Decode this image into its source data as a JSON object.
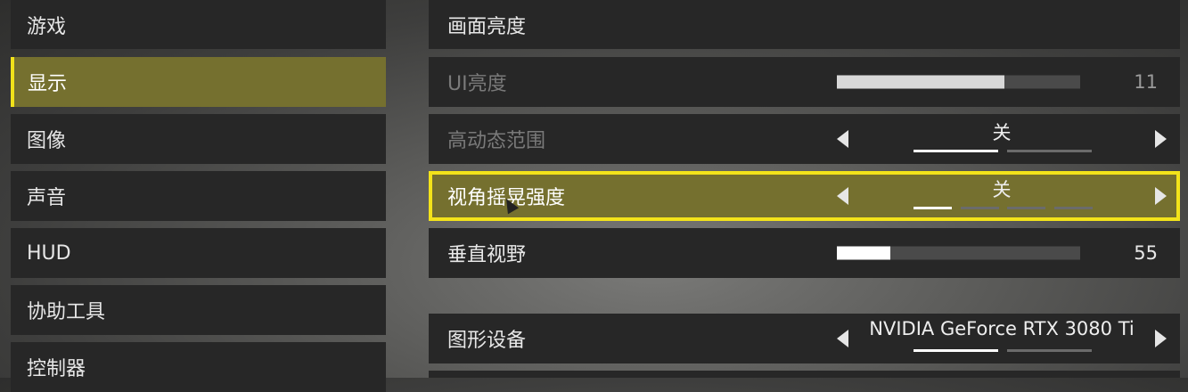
{
  "sidebar": {
    "items": [
      {
        "label": "游戏"
      },
      {
        "label": "显示"
      },
      {
        "label": "图像"
      },
      {
        "label": "声音"
      },
      {
        "label": "HUD"
      },
      {
        "label": "协助工具"
      },
      {
        "label": "控制器"
      }
    ],
    "active_index": 1
  },
  "settings": {
    "section_title": "画面亮度",
    "ui_brightness": {
      "label": "UI亮度",
      "value": "11",
      "level": 0.69
    },
    "hdr": {
      "label": "高动态范围",
      "value": "关"
    },
    "camera_shake": {
      "label": "视角摇晃强度",
      "value": "关"
    },
    "fov": {
      "label": "垂直视野",
      "value": "55",
      "level": 0.22
    },
    "graphics_device": {
      "label": "图形设备",
      "value": "NVIDIA GeForce RTX 3080 Ti"
    }
  },
  "colors": {
    "accent": "#f3e31a",
    "active_bg": "#75702f",
    "row_bg": "#272727"
  }
}
